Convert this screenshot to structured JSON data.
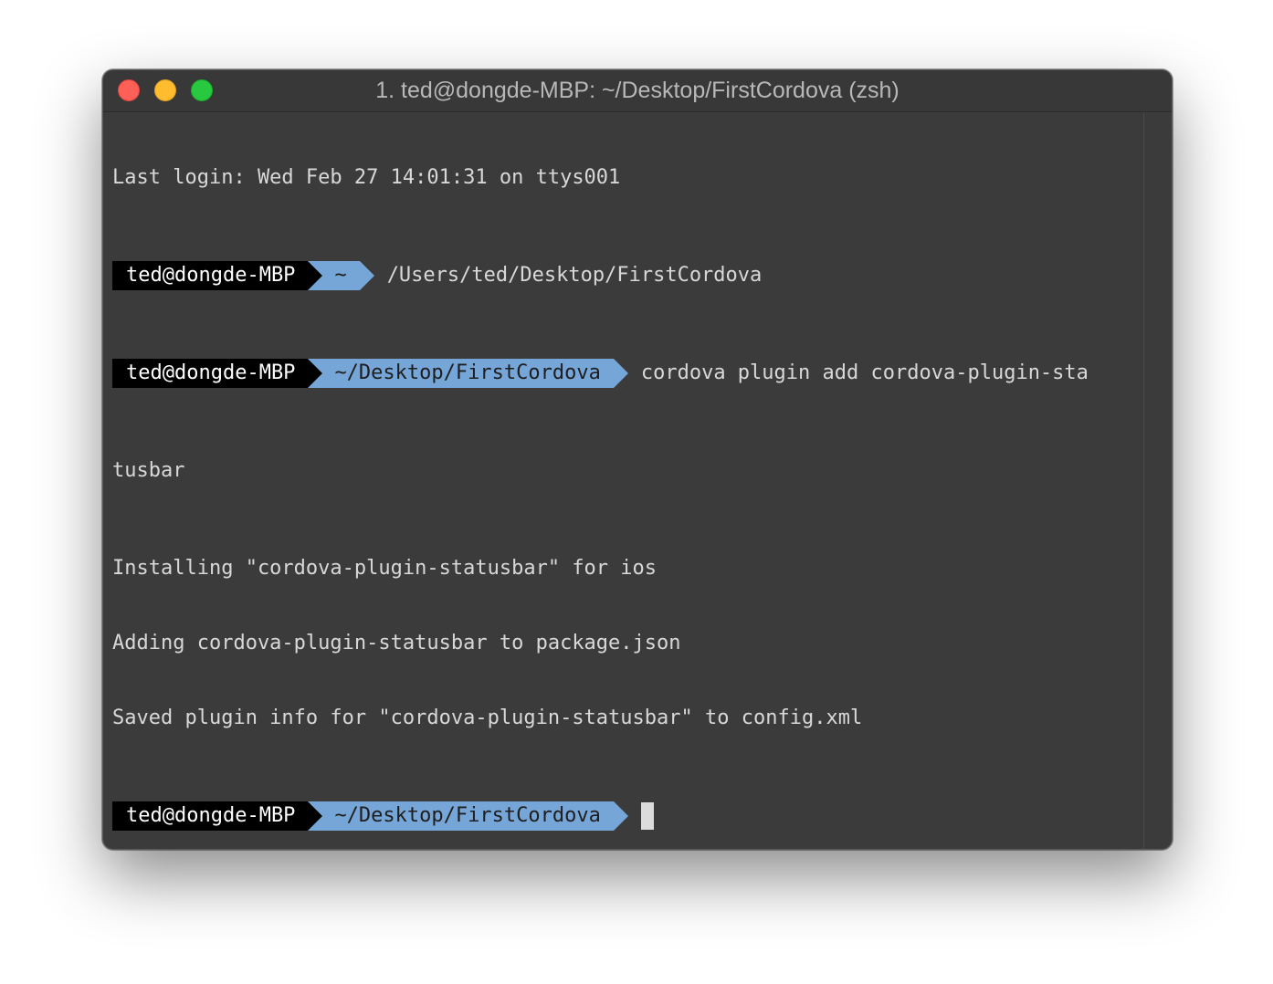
{
  "window": {
    "title": "1. ted@dongde-MBP: ~/Desktop/FirstCordova (zsh)"
  },
  "terminal": {
    "last_login": "Last login: Wed Feb 27 14:01:31 on ttys001",
    "prompt1": {
      "user": "ted@dongde-MBP",
      "path": "~",
      "command": "/Users/ted/Desktop/FirstCordova"
    },
    "prompt2": {
      "user": "ted@dongde-MBP",
      "path": "~/Desktop/FirstCordova",
      "command": "cordova plugin add cordova-plugin-sta"
    },
    "wrap_line": "tusbar",
    "output": [
      "Installing \"cordova-plugin-statusbar\" for ios",
      "Adding cordova-plugin-statusbar to package.json",
      "Saved plugin info for \"cordova-plugin-statusbar\" to config.xml"
    ],
    "prompt3": {
      "user": "ted@dongde-MBP",
      "path": "~/Desktop/FirstCordova"
    }
  },
  "colors": {
    "user_segment_bg": "#000000",
    "path_segment_bg": "#76a5d7",
    "terminal_bg": "#3b3b3b",
    "close": "#fe5f57",
    "minimize": "#febc2e",
    "zoom": "#28c840"
  }
}
